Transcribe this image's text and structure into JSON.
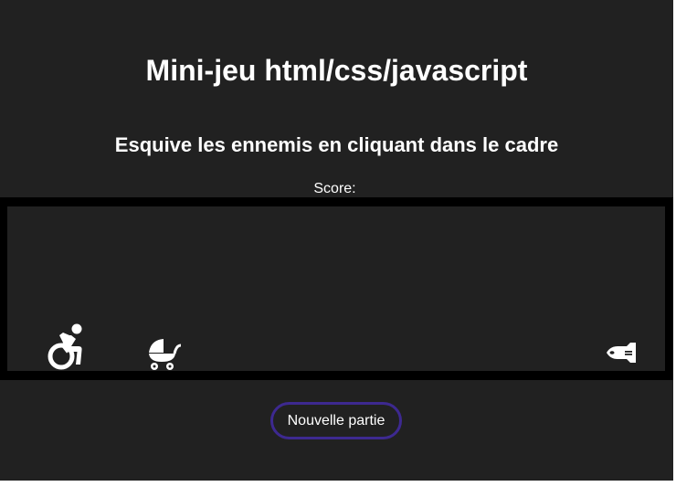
{
  "header": {
    "title": "Mini-jeu html/css/javascript",
    "subtitle": "Esquive les ennemis en cliquant dans le cadre"
  },
  "score": {
    "label": "Score:",
    "value": ""
  },
  "game": {
    "player_icon": "wheelchair-icon",
    "enemies": [
      "baby-carriage-icon",
      "space-shuttle-icon"
    ],
    "frame_color": "#000000",
    "background_color": "#212121"
  },
  "controls": {
    "new_game_label": "Nouvelle partie",
    "button_border_color": "#3d2990"
  }
}
